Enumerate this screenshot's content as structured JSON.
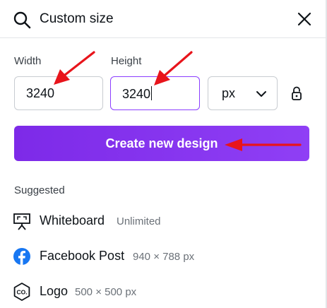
{
  "search": {
    "value": "Custom size"
  },
  "fields": {
    "width_label": "Width",
    "height_label": "Height",
    "width_value": "3240",
    "height_value": "3240",
    "unit_value": "px"
  },
  "create_button_label": "Create new design",
  "suggested": {
    "title": "Suggested",
    "items": [
      {
        "name": "Whiteboard",
        "meta": "Unlimited",
        "icon": "whiteboard-icon"
      },
      {
        "name": "Facebook Post",
        "meta": "940 × 788 px",
        "icon": "facebook-icon"
      },
      {
        "name": "Logo",
        "meta": "500 × 500 px",
        "icon": "logo-icon"
      }
    ]
  },
  "colors": {
    "accent": "#8b3dff",
    "annotation_arrow": "#e8141b"
  }
}
